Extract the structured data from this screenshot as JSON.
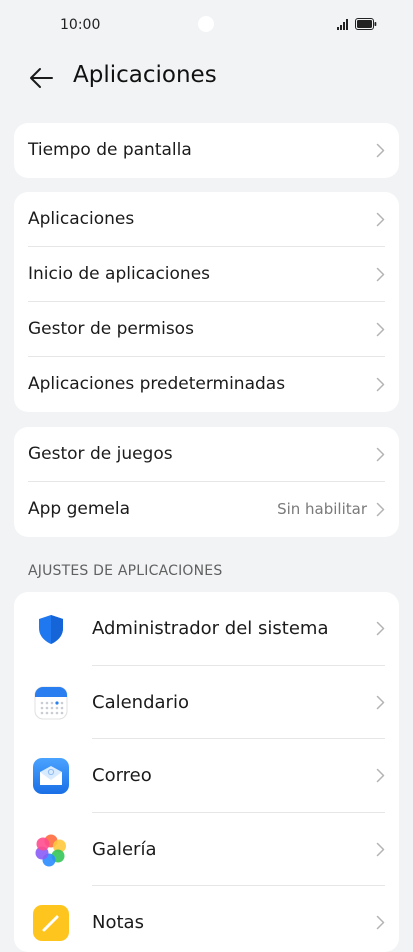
{
  "status": {
    "time": "10:00"
  },
  "header": {
    "title": "Aplicaciones"
  },
  "group1": [
    {
      "label": "Tiempo de pantalla"
    }
  ],
  "group2": [
    {
      "label": "Aplicaciones"
    },
    {
      "label": "Inicio de aplicaciones"
    },
    {
      "label": "Gestor de permisos"
    },
    {
      "label": "Aplicaciones predeterminadas"
    }
  ],
  "group3": [
    {
      "label": "Gestor de juegos",
      "value": ""
    },
    {
      "label": "App gemela",
      "value": "Sin habilitar"
    }
  ],
  "section_title": "AJUSTES DE APLICACIONES",
  "apps": [
    {
      "label": "Administrador del sistema",
      "icon": "shield-icon"
    },
    {
      "label": "Calendario",
      "icon": "calendar-icon"
    },
    {
      "label": "Correo",
      "icon": "mail-icon"
    },
    {
      "label": "Galería",
      "icon": "gallery-flower-icon"
    },
    {
      "label": "Notas",
      "icon": "notes-icon"
    }
  ]
}
